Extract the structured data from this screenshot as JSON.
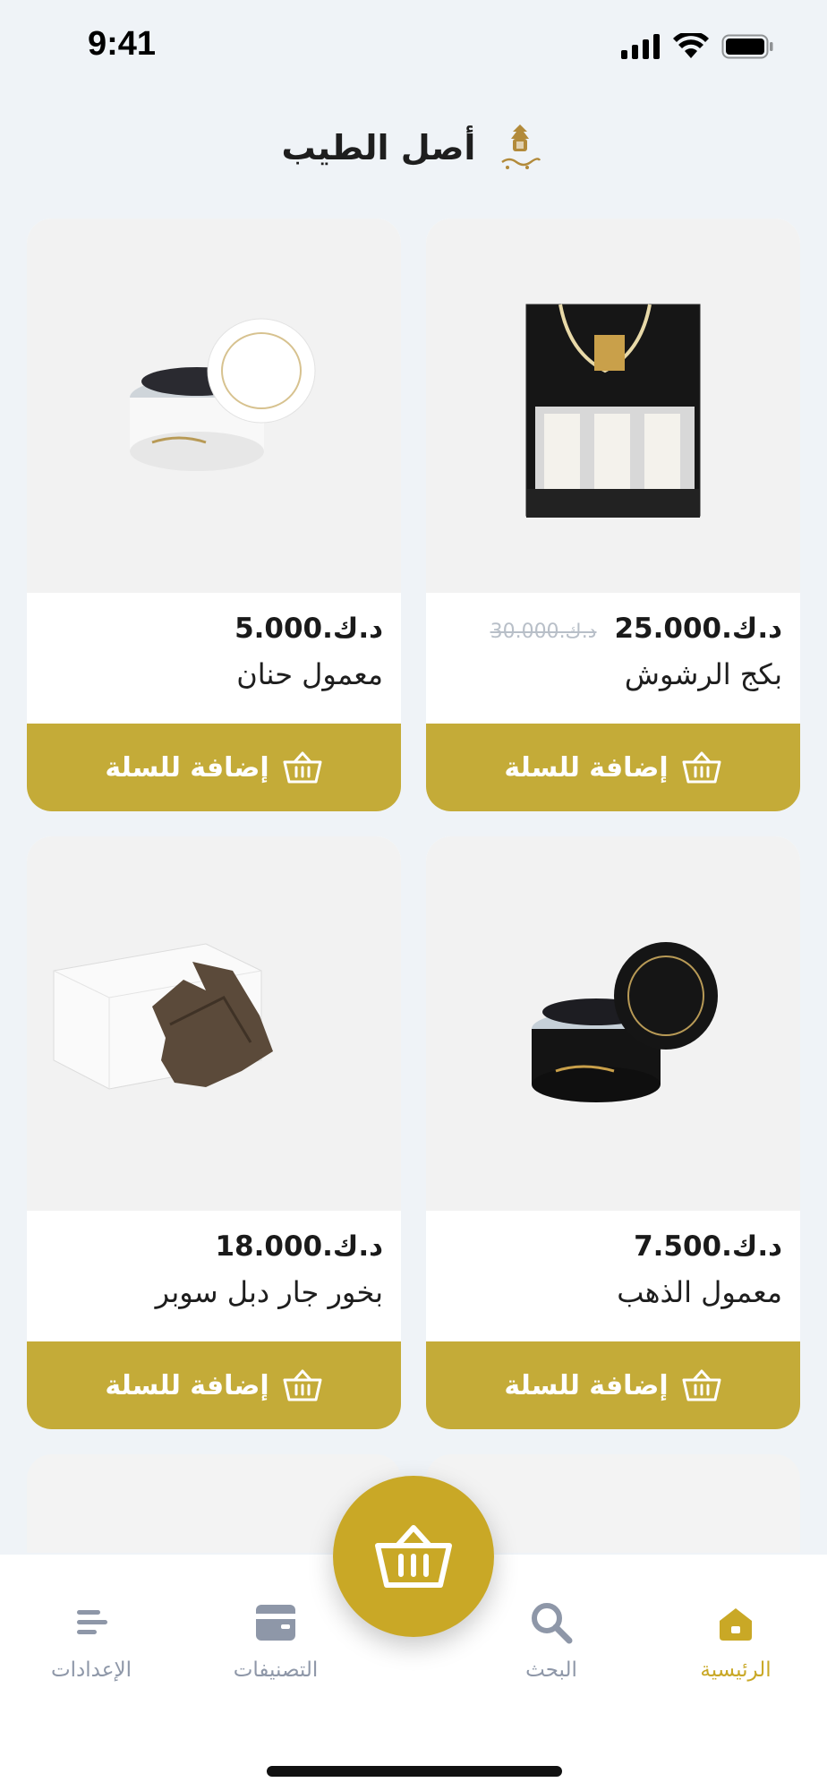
{
  "status": {
    "time": "9:41"
  },
  "header": {
    "title": "أصل الطيب",
    "logo_text": "أصل الطيب"
  },
  "currency": "د.ك.",
  "add_to_cart_label": "إضافة للسلة",
  "products": [
    {
      "name": "بكج الرشوش",
      "price": "25.000",
      "old_price": "30.000",
      "image": "gift-box-with-bottles"
    },
    {
      "name": "معمول حنان",
      "price": "5.000",
      "old_price": "",
      "image": "white-jar"
    },
    {
      "name": "معمول الذهب",
      "price": "7.500",
      "old_price": "",
      "image": "black-jar"
    },
    {
      "name": "بخور جار دبل سوبر",
      "price": "18.000",
      "old_price": "",
      "image": "oud-wood-with-box"
    }
  ],
  "nav": {
    "home": "الرئيسية",
    "search": "البحث",
    "categories": "التصنيفات",
    "settings": "الإعدادات"
  },
  "colors": {
    "accent": "#c4ab38",
    "fab": "#c9a826",
    "nav_inactive": "#8e97a8",
    "background": "#eff3f7"
  }
}
